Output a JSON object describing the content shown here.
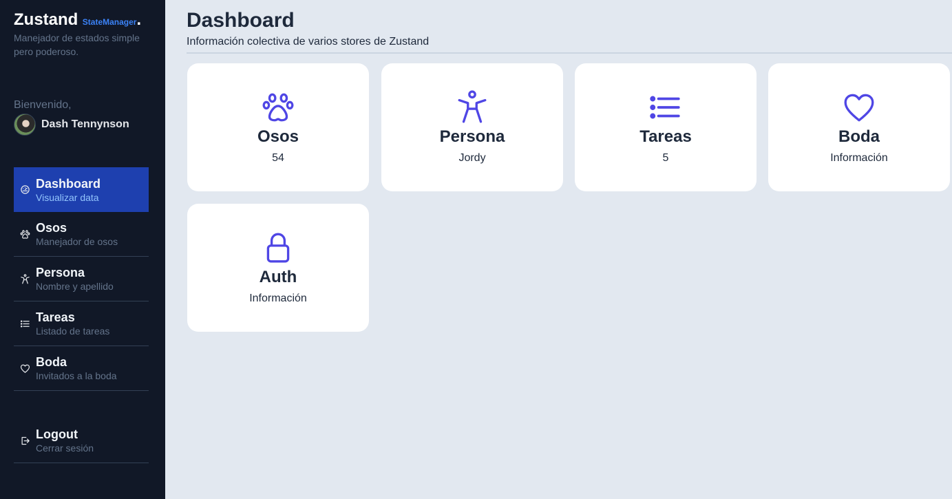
{
  "sidebar": {
    "brand": {
      "title": "Zustand",
      "subtitle": "StateManager",
      "dot": "."
    },
    "tagline": "Manejador de estados simple pero poderoso.",
    "welcome": "Bienvenido,",
    "user_name": "Dash Tennynson",
    "items": [
      {
        "label": "Dashboard",
        "desc": "Visualizar data",
        "icon": "gauge-icon",
        "active": true
      },
      {
        "label": "Osos",
        "desc": "Manejador de osos",
        "icon": "paw-icon"
      },
      {
        "label": "Persona",
        "desc": "Nombre y apellido",
        "icon": "person-icon"
      },
      {
        "label": "Tareas",
        "desc": "Listado de tareas",
        "icon": "list-icon"
      },
      {
        "label": "Boda",
        "desc": "Invitados a la boda",
        "icon": "heart-icon"
      }
    ],
    "logout": {
      "label": "Logout",
      "desc": "Cerrar sesión",
      "icon": "logout-icon"
    }
  },
  "main": {
    "title": "Dashboard",
    "subtitle": "Información colectiva de varios stores de Zustand",
    "cards": [
      {
        "title": "Osos",
        "value": "54",
        "icon": "paw-icon"
      },
      {
        "title": "Persona",
        "value": "Jordy",
        "icon": "person-icon"
      },
      {
        "title": "Tareas",
        "value": "5",
        "icon": "list-icon"
      },
      {
        "title": "Boda",
        "value": "Información",
        "icon": "heart-icon"
      },
      {
        "title": "Auth",
        "value": "Información",
        "icon": "lock-icon"
      }
    ]
  },
  "colors": {
    "sidebar_bg": "#111827",
    "accent": "#1e40af",
    "brand_accent": "#3b82f6",
    "icon": "#4f46e5",
    "page_bg": "#e2e8f0"
  }
}
